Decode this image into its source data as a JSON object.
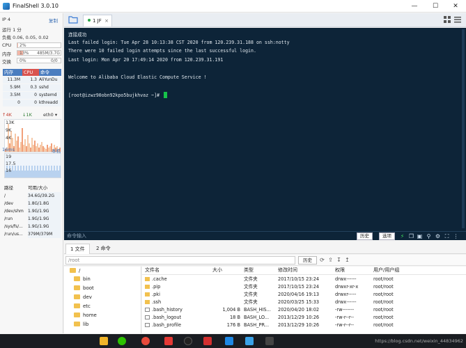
{
  "window": {
    "title": "FinalShell 3.0.10",
    "controls": {
      "minimize": "—",
      "maximize": "☐",
      "close": "✕"
    }
  },
  "sidebar": {
    "ip_label": "IP 4",
    "copy_label": "复制",
    "uptime": "运行 1 分",
    "load": "负载 0.06, 0.05, 0.02",
    "cpu": {
      "label": "CPU",
      "value": "2%",
      "fraction": 0.02
    },
    "mem": {
      "label": "内存",
      "value": "13%",
      "detail": "485M/3.7G",
      "fraction": 0.13
    },
    "swap": {
      "label": "交换",
      "value": "0%",
      "detail": "0/0",
      "fraction": 0
    },
    "proc_headers": {
      "mem": "内存",
      "cpu": "CPU",
      "cmd": "命令"
    },
    "processes": [
      {
        "mem": "11.3M",
        "cpu": "1.3",
        "cmd": "AliYunDu"
      },
      {
        "mem": "5.9M",
        "cpu": "0.3",
        "cmd": "sshd"
      },
      {
        "mem": "3.5M",
        "cpu": "0",
        "cmd": "systemd"
      },
      {
        "mem": "0",
        "cpu": "0",
        "cmd": "kthreadd"
      }
    ],
    "net": {
      "up": "4K",
      "down": "1K",
      "iface": "eth0",
      "yticks": [
        "13K",
        "9K",
        "4K"
      ]
    },
    "ping": {
      "latency": "16ms",
      "host": "本机",
      "yticks": [
        "19",
        "17.5",
        "16"
      ]
    },
    "disk_headers": {
      "path": "路径",
      "avail": "可用/大小"
    },
    "disks": [
      {
        "path": "/",
        "size": "34.6G/39.2G"
      },
      {
        "path": "/dev",
        "size": "1.8G/1.8G"
      },
      {
        "path": "/dev/shm",
        "size": "1.9G/1.9G"
      },
      {
        "path": "/run",
        "size": "1.9G/1.9G"
      },
      {
        "path": "/sys/fs/...",
        "size": "1.9G/1.9G"
      },
      {
        "path": "/run/us...",
        "size": "379M/379M"
      }
    ]
  },
  "tabs": [
    {
      "label": "1 JF",
      "close": "×"
    }
  ],
  "terminal": {
    "lines": [
      "连接成功",
      "Last failed login: Tue Apr 28 10:13:38 CST 2020 from 120.239.31.188 on ssh:notty",
      "There were 10 failed login attempts since the last successful login.",
      "Last login: Mon Apr 20 17:49:14 2020 from 120.239.31.191",
      "",
      "Welcome to Alibaba Cloud Elastic Compute Service !",
      "",
      "[root@izwz90obn92kpo5bujkhvaz ~]# "
    ]
  },
  "cmdbar": {
    "placeholder": "命令输入",
    "history": "历史",
    "options": "选项"
  },
  "bottom_tabs": [
    {
      "label": "1 文件"
    },
    {
      "label": "2 命令"
    }
  ],
  "filebrowser": {
    "path": "/root",
    "history": "历史",
    "tree_root": "/",
    "tree": [
      "bin",
      "boot",
      "dev",
      "etc",
      "home",
      "lib"
    ],
    "headers": {
      "name": "文件名",
      "size": "大小",
      "type": "类型",
      "mtime": "修改时间",
      "perm": "权限",
      "owner": "用户/用户组"
    },
    "files": [
      {
        "name": ".cache",
        "size": "",
        "type": "文件夹",
        "mtime": "2017/10/15 23:24",
        "perm": "drwx------",
        "owner": "root/root",
        "kind": "folder"
      },
      {
        "name": ".pip",
        "size": "",
        "type": "文件夹",
        "mtime": "2017/10/15 23:24",
        "perm": "drwxr-xr-x",
        "owner": "root/root",
        "kind": "folder"
      },
      {
        "name": ".pki",
        "size": "",
        "type": "文件夹",
        "mtime": "2020/04/16 19:13",
        "perm": "drwxr-----",
        "owner": "root/root",
        "kind": "folder"
      },
      {
        "name": ".ssh",
        "size": "",
        "type": "文件夹",
        "mtime": "2020/03/25 15:33",
        "perm": "drwx------",
        "owner": "root/root",
        "kind": "folder"
      },
      {
        "name": ".bash_history",
        "size": "1,004 B",
        "type": "BASH_HIS...",
        "mtime": "2020/04/20 18:02",
        "perm": "-rw-------",
        "owner": "root/root",
        "kind": "file"
      },
      {
        "name": ".bash_logout",
        "size": "18 B",
        "type": "BASH_LO...",
        "mtime": "2013/12/29 10:26",
        "perm": "-rw-r--r--",
        "owner": "root/root",
        "kind": "file"
      },
      {
        "name": ".bash_profile",
        "size": "176 B",
        "type": "BASH_PR...",
        "mtime": "2013/12/29 10:26",
        "perm": "-rw-r--r--",
        "owner": "root/root",
        "kind": "file"
      }
    ]
  },
  "watermark": "https://blog.csdn.net/weixin_44834962",
  "colors": {
    "terminal_bg": "#0d2438",
    "cursor": "#16c24a",
    "cpu_header": "#d9534f",
    "mem_header": "#4a7dbf"
  }
}
